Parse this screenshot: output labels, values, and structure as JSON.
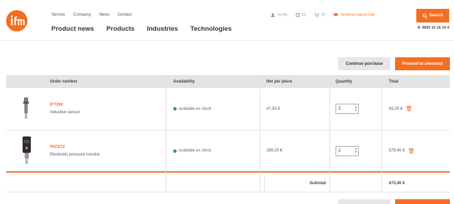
{
  "header": {
    "top_nav": [
      "Service",
      "Company",
      "News",
      "Contact"
    ],
    "main_nav": [
      "Product news",
      "Products",
      "Industries",
      "Technologies"
    ],
    "utilities": [
      {
        "label": "my ifm",
        "icon": "user-icon"
      },
      {
        "label": "(0)",
        "icon": "compare-icon"
      },
      {
        "label": "(2)",
        "icon": "cart-icon"
      },
      {
        "label": "Technical support chat",
        "icon": "chat-icon"
      }
    ],
    "search_label": "Search",
    "phone": "0800 16 16 16 4"
  },
  "actions": {
    "continue_label": "Continue purchase",
    "checkout_label": "Proceed to checkout"
  },
  "table": {
    "headers": [
      "Order number",
      "Availability",
      "Net per piece",
      "Quantity",
      "Total"
    ],
    "rows": [
      {
        "sku": "IFT200",
        "description": "Inductive sensor",
        "availability": "available ex stock",
        "price": "47,50 €",
        "quantity": "2",
        "total": "95,00 €"
      },
      {
        "sku": "PN7072",
        "description": "Electronic pressure monitor",
        "availability": "available ex stock",
        "price": "289,20 €",
        "quantity": "2",
        "total": "578,40 €"
      }
    ],
    "subtotal_label": "Subtotal",
    "subtotal_value": "673,40 €"
  },
  "colors": {
    "accent": "#f36f21",
    "stock_green": "#3aa03a",
    "header_grey": "#e4e4e4"
  }
}
